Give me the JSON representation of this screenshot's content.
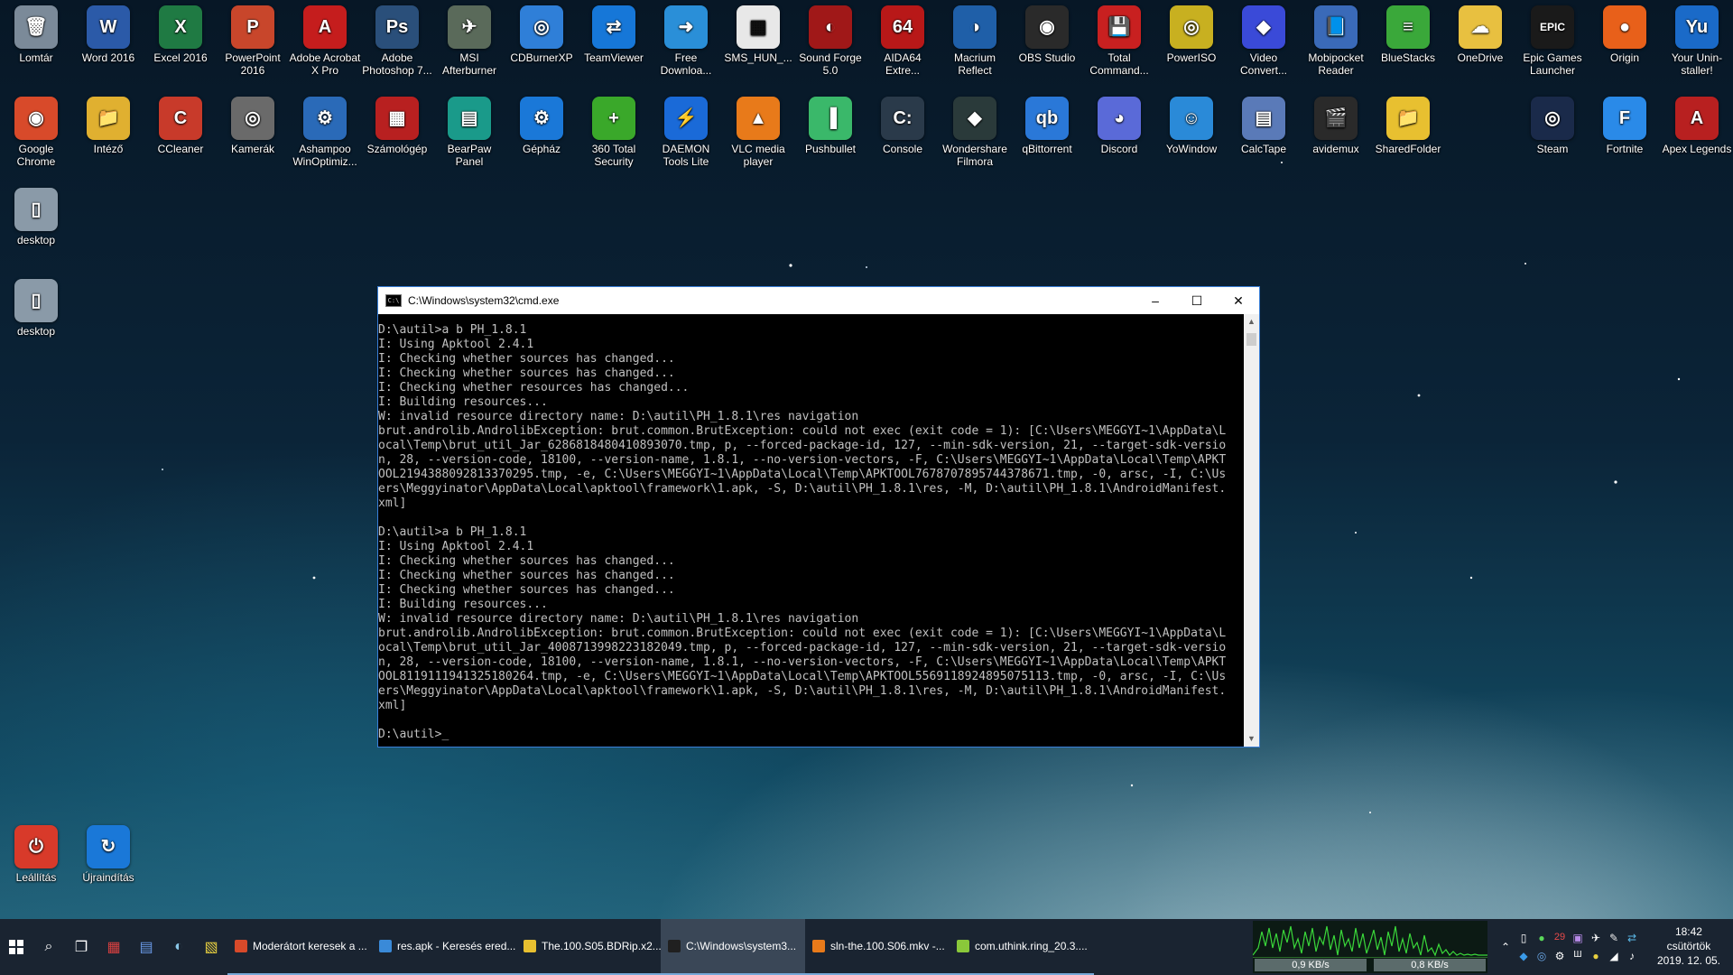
{
  "desktop": {
    "row1": [
      {
        "label": "Lomtár",
        "icon": "recycle-bin-icon",
        "color": "#7b8a99",
        "glyph": "🗑"
      },
      {
        "label": "Word 2016",
        "icon": "word-icon",
        "color": "#2b5aa8",
        "glyph": "W"
      },
      {
        "label": "Excel 2016",
        "icon": "excel-icon",
        "color": "#1f7a43",
        "glyph": "X"
      },
      {
        "label": "PowerPoint 2016",
        "icon": "powerpoint-icon",
        "color": "#c8462b",
        "glyph": "P"
      },
      {
        "label": "Adobe Acrobat X Pro",
        "icon": "acrobat-icon",
        "color": "#c51d1d",
        "glyph": "A"
      },
      {
        "label": "Adobe Photoshop 7...",
        "icon": "photoshop-icon",
        "color": "#2a4f7a",
        "glyph": "Ps"
      },
      {
        "label": "MSI Afterburner",
        "icon": "afterburner-icon",
        "color": "#5a6a5a",
        "glyph": "✈"
      },
      {
        "label": "CDBurnerXP",
        "icon": "cdburner-icon",
        "color": "#2f7fd8",
        "glyph": "◎"
      },
      {
        "label": "TeamViewer",
        "icon": "teamviewer-icon",
        "color": "#1677d8",
        "glyph": "⇄"
      },
      {
        "label": "Free Downloa...",
        "icon": "free-download-icon",
        "color": "#2a8fd8",
        "glyph": "➜"
      },
      {
        "label": "SMS_HUN_...",
        "icon": "qr-code-icon",
        "color": "#e8e8e8",
        "glyph": "▦"
      },
      {
        "label": "Sound Forge 5.0",
        "icon": "sound-forge-icon",
        "color": "#a01818",
        "glyph": "◐"
      },
      {
        "label": "AIDA64 Extre...",
        "icon": "aida64-icon",
        "color": "#b81818",
        "glyph": "64"
      },
      {
        "label": "Macrium Reflect",
        "icon": "macrium-icon",
        "color": "#1f5fa8",
        "glyph": "◑"
      },
      {
        "label": "OBS Studio",
        "icon": "obs-icon",
        "color": "#2a2a2a",
        "glyph": "◉"
      },
      {
        "label": "Total Command...",
        "icon": "total-commander-icon",
        "color": "#c82020",
        "glyph": "💾"
      },
      {
        "label": "PowerISO",
        "icon": "poweriso-icon",
        "color": "#c8b020",
        "glyph": "◎"
      },
      {
        "label": "Video Convert...",
        "icon": "video-converter-icon",
        "color": "#3a4ad8",
        "glyph": "◆"
      },
      {
        "label": "Mobipocket Reader",
        "icon": "mobipocket-icon",
        "color": "#3a6ab8",
        "glyph": "📘"
      },
      {
        "label": "BlueStacks",
        "icon": "bluestacks-icon",
        "color": "#3aa83a",
        "glyph": "≡"
      },
      {
        "label": "OneDrive",
        "icon": "onedrive-icon",
        "color": "#e8c040",
        "glyph": "☁"
      },
      {
        "label": "Epic Games Launcher",
        "icon": "epic-games-icon",
        "color": "#1a1a1a",
        "glyph": "EPIC"
      },
      {
        "label": "Origin",
        "icon": "origin-icon",
        "color": "#e8601a",
        "glyph": "●"
      },
      {
        "label": "Your Unin-staller!",
        "icon": "uninstaller-icon",
        "color": "#1a6ac8",
        "glyph": "Yu"
      }
    ],
    "row2": [
      {
        "label": "Google Chrome",
        "icon": "chrome-icon",
        "color": "#d84a2a",
        "glyph": "◉"
      },
      {
        "label": "Intéző",
        "icon": "file-explorer-icon",
        "color": "#e0b030",
        "glyph": "📁"
      },
      {
        "label": "CCleaner",
        "icon": "ccleaner-icon",
        "color": "#c83a2a",
        "glyph": "C"
      },
      {
        "label": "Kamerák",
        "icon": "camera-icon",
        "color": "#6a6a6a",
        "glyph": "◎"
      },
      {
        "label": "Ashampoo WinOptimiz...",
        "icon": "ashampoo-icon",
        "color": "#2a6ab8",
        "glyph": "⚙"
      },
      {
        "label": "Számológép",
        "icon": "calculator-icon",
        "color": "#b82020",
        "glyph": "▦"
      },
      {
        "label": "BearPaw Panel",
        "icon": "scanner-icon",
        "color": "#1a9a8a",
        "glyph": "▤"
      },
      {
        "label": "Gépház",
        "icon": "settings-gear-icon",
        "color": "#1a78d8",
        "glyph": "⚙"
      },
      {
        "label": "360 Total Security",
        "icon": "total-security-icon",
        "color": "#3aa82a",
        "glyph": "+"
      },
      {
        "label": "DAEMON Tools Lite",
        "icon": "daemon-tools-icon",
        "color": "#1a6ad8",
        "glyph": "⚡"
      },
      {
        "label": "VLC media player",
        "icon": "vlc-icon",
        "color": "#e87a1a",
        "glyph": "▲"
      },
      {
        "label": "Pushbullet",
        "icon": "pushbullet-icon",
        "color": "#3ab86a",
        "glyph": "▐"
      },
      {
        "label": "Console",
        "icon": "console-icon",
        "color": "#2a3a4a",
        "glyph": "C:"
      },
      {
        "label": "Wondershare Filmora",
        "icon": "filmora-icon",
        "color": "#2a3a3a",
        "glyph": "◆"
      },
      {
        "label": "qBittorrent",
        "icon": "qbittorrent-icon",
        "color": "#2a78d8",
        "glyph": "qb"
      },
      {
        "label": "Discord",
        "icon": "discord-icon",
        "color": "#5a6ad8",
        "glyph": "◕"
      },
      {
        "label": "YoWindow",
        "icon": "yowindow-icon",
        "color": "#2a8ad8",
        "glyph": "☺"
      },
      {
        "label": "CalcTape",
        "icon": "calctape-icon",
        "color": "#5a7ab8",
        "glyph": "▤"
      },
      {
        "label": "avidemux",
        "icon": "avidemux-icon",
        "color": "#2a2a2a",
        "glyph": "🎬"
      },
      {
        "label": "SharedFolder",
        "icon": "shared-folder-icon",
        "color": "#e8c030",
        "glyph": "📁"
      },
      {
        "label": "",
        "icon": "",
        "color": "",
        "glyph": ""
      },
      {
        "label": "Steam",
        "icon": "steam-icon",
        "color": "#1a2a4a",
        "glyph": "◎"
      },
      {
        "label": "Fortnite",
        "icon": "fortnite-icon",
        "color": "#2a8ae8",
        "glyph": "F"
      },
      {
        "label": "Apex Legends",
        "icon": "apex-legends-icon",
        "color": "#b82020",
        "glyph": "A"
      }
    ],
    "left_column": [
      {
        "label": "desktop",
        "icon": "file-icon",
        "color": "#8a9aa8",
        "glyph": "▯"
      },
      {
        "label": "desktop",
        "icon": "file-icon",
        "color": "#8a9aa8",
        "glyph": "▯"
      }
    ],
    "bottom": [
      {
        "label": "Leállítás",
        "icon": "power-icon",
        "color": "#d83a2a",
        "glyph": "⏻"
      },
      {
        "label": "Újraindítás",
        "icon": "restart-icon",
        "color": "#1a78d8",
        "glyph": "↻"
      }
    ]
  },
  "cmd": {
    "title": "C:\\Windows\\system32\\cmd.exe",
    "lines": [
      "D:\\autil>a b PH_1.8.1",
      "I: Using Apktool 2.4.1",
      "I: Checking whether sources has changed...",
      "I: Checking whether sources has changed...",
      "I: Checking whether resources has changed...",
      "I: Building resources...",
      "W: invalid resource directory name: D:\\autil\\PH_1.8.1\\res navigation",
      "brut.androlib.AndrolibException: brut.common.BrutException: could not exec (exit code = 1): [C:\\Users\\MEGGYI~1\\AppData\\L",
      "ocal\\Temp\\brut_util_Jar_6286818480410893070.tmp, p, --forced-package-id, 127, --min-sdk-version, 21, --target-sdk-versio",
      "n, 28, --version-code, 18100, --version-name, 1.8.1, --no-version-vectors, -F, C:\\Users\\MEGGYI~1\\AppData\\Local\\Temp\\APKT",
      "OOL2194388092813370295.tmp, -e, C:\\Users\\MEGGYI~1\\AppData\\Local\\Temp\\APKTOOL7678707895744378671.tmp, -0, arsc, -I, C:\\Us",
      "ers\\Meggyinator\\AppData\\Local\\apktool\\framework\\1.apk, -S, D:\\autil\\PH_1.8.1\\res, -M, D:\\autil\\PH_1.8.1\\AndroidManifest.",
      "xml]",
      "",
      "D:\\autil>a b PH_1.8.1",
      "I: Using Apktool 2.4.1",
      "I: Checking whether sources has changed...",
      "I: Checking whether sources has changed...",
      "I: Checking whether sources has changed...",
      "I: Building resources...",
      "W: invalid resource directory name: D:\\autil\\PH_1.8.1\\res navigation",
      "brut.androlib.AndrolibException: brut.common.BrutException: could not exec (exit code = 1): [C:\\Users\\MEGGYI~1\\AppData\\L",
      "ocal\\Temp\\brut_util_Jar_4008713998223182049.tmp, p, --forced-package-id, 127, --min-sdk-version, 21, --target-sdk-versio",
      "n, 28, --version-code, 18100, --version-name, 1.8.1, --no-version-vectors, -F, C:\\Users\\MEGGYI~1\\AppData\\Local\\Temp\\APKT",
      "OOL8119111941325180264.tmp, -e, C:\\Users\\MEGGYI~1\\AppData\\Local\\Temp\\APKTOOL5569118924895075113.tmp, -0, arsc, -I, C:\\Us",
      "ers\\Meggyinator\\AppData\\Local\\apktool\\framework\\1.apk, -S, D:\\autil\\PH_1.8.1\\res, -M, D:\\autil\\PH_1.8.1\\AndroidManifest.",
      "xml]",
      "",
      "D:\\autil>"
    ]
  },
  "taskbar": {
    "apps": [
      {
        "label": "Moderátort keresek a ...",
        "icon": "chrome-icon",
        "color": "#d84a2a",
        "active": false
      },
      {
        "label": "res.apk - Keresés ered...",
        "icon": "search-window-icon",
        "color": "#3a8ad8",
        "active": false
      },
      {
        "label": "The.100.S05.BDRip.x2...",
        "icon": "folder-icon",
        "color": "#e8c030",
        "active": false
      },
      {
        "label": "C:\\Windows\\system3...",
        "icon": "cmd-icon",
        "color": "#202020",
        "active": true
      },
      {
        "label": "sln-the.100.S06.mkv -...",
        "icon": "vlc-icon",
        "color": "#e87a1a",
        "active": false
      },
      {
        "label": "com.uthink.ring_20.3....",
        "icon": "android-icon",
        "color": "#8ac83a",
        "active": false
      }
    ],
    "net_down": "0,9 KB/s",
    "net_up": "0,8 KB/s",
    "tray_badge": "29",
    "clock_time": "18:42",
    "clock_day": "csütörtök",
    "clock_date": "2019. 12. 05."
  }
}
